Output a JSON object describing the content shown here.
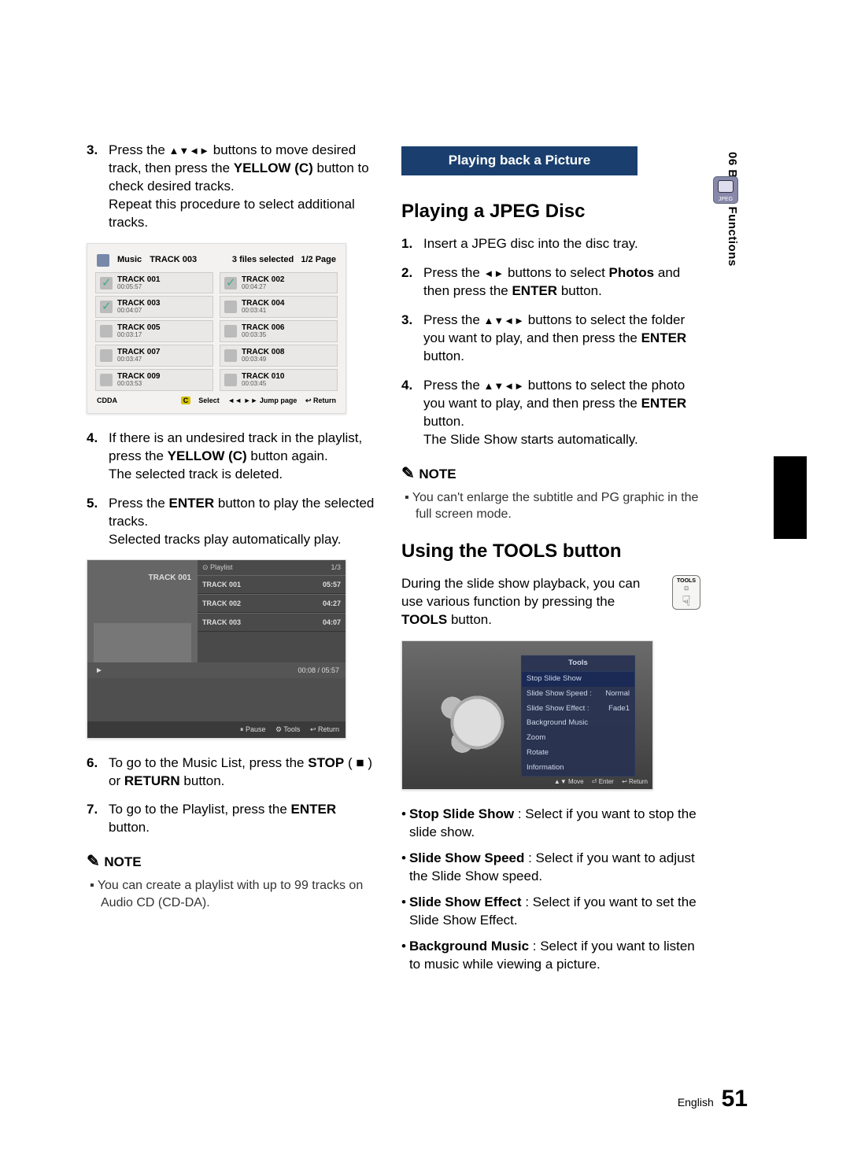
{
  "sideTab": "06 Basic Functions",
  "jpegBadge": "JPEG",
  "left": {
    "step3a": "Press the ",
    "step3arrows": "▲▼◄►",
    "step3b": " buttons to move desired track, then press the ",
    "step3c": "YELLOW (C)",
    "step3d": " button to check desired tracks.",
    "step3e": "Repeat this procedure to select additional tracks.",
    "step4a": "If there is an undesired track in the playlist, press the ",
    "step4b": "YELLOW (C)",
    "step4c": " button again.",
    "step4d": "The selected track is deleted.",
    "step5a": "Press the ",
    "step5b": "ENTER",
    "step5c": " button to play the selected tracks.",
    "step5d": "Selected tracks play automatically play.",
    "step6a": "To go to the Music List, press the ",
    "step6b": "STOP",
    "step6c": " ( ■ ) or ",
    "step6d": "RETURN",
    "step6e": " button.",
    "step7a": "To go to the Playlist, press the ",
    "step7b": "ENTER",
    "step7c": " button.",
    "noteHead": "NOTE",
    "note1": "You can create a playlist with up to 99 tracks on Audio CD (CD-DA)."
  },
  "musicFig": {
    "title": "Music",
    "current": "TRACK 003",
    "selected": "3 files selected",
    "page": "1/2 Page",
    "tracks": [
      {
        "t": "TRACK 001",
        "d": "00:05:57",
        "sel": true
      },
      {
        "t": "TRACK 002",
        "d": "00:04:27",
        "sel": true
      },
      {
        "t": "TRACK 003",
        "d": "00:04:07",
        "sel": true
      },
      {
        "t": "TRACK 004",
        "d": "00:03:41",
        "sel": false
      },
      {
        "t": "TRACK 005",
        "d": "00:03:17",
        "sel": false
      },
      {
        "t": "TRACK 006",
        "d": "00:03:35",
        "sel": false
      },
      {
        "t": "TRACK 007",
        "d": "00:03:47",
        "sel": false
      },
      {
        "t": "TRACK 008",
        "d": "00:03:49",
        "sel": false
      },
      {
        "t": "TRACK 009",
        "d": "00:03:53",
        "sel": false
      },
      {
        "t": "TRACK 010",
        "d": "00:03:45",
        "sel": false
      }
    ],
    "footLeft": "CDDA",
    "footSelect": "Select",
    "footJump": "◄◄ ►► Jump page",
    "footReturn": "↩ Return"
  },
  "playlistFig": {
    "head": "Playlist",
    "page": "1/3",
    "now": "TRACK 001",
    "time": "00:08 / 05:57",
    "rows": [
      {
        "t": "TRACK 001",
        "d": "05:57"
      },
      {
        "t": "TRACK 002",
        "d": "04:27"
      },
      {
        "t": "TRACK 003",
        "d": "04:07"
      }
    ],
    "footPause": "⏸ Pause",
    "footTools": "⚙ Tools",
    "footReturn": "↩ Return"
  },
  "right": {
    "sectionBar": "Playing back a Picture",
    "h2a": "Playing a JPEG Disc",
    "s1": "Insert a JPEG disc into the disc tray.",
    "s2a": "Press the ",
    "s2arrows": "◄►",
    "s2b": " buttons to select ",
    "s2c": "Photos",
    "s2d": " and then press the ",
    "s2e": "ENTER",
    "s2f": " button.",
    "s3a": "Press the ",
    "s3arrows": "▲▼◄►",
    "s3b": " buttons to select the folder you want to play, and then press the ",
    "s3c": "ENTER",
    "s3d": " button.",
    "s4a": "Press the ",
    "s4arrows": "▲▼◄►",
    "s4b": " buttons to select the photo you want to play, and then press the ",
    "s4c": "ENTER",
    "s4d": " button.",
    "s4e": "The Slide Show starts automatically.",
    "noteHead": "NOTE",
    "note1": "You can't enlarge the subtitle and PG graphic in the full screen mode.",
    "h2b": "Using the TOOLS button",
    "toolsPara1": "During the slide show playback, you can use various function by pressing the ",
    "toolsPara2": "TOOLS",
    "toolsPara3": " button.",
    "toolsBtnLabel": "TOOLS",
    "bullets": [
      {
        "t": "Stop Slide Show",
        "d": " : Select if you want to stop the slide show."
      },
      {
        "t": "Slide Show Speed",
        "d": " : Select if you want to adjust the Slide Show speed."
      },
      {
        "t": "Slide Show Effect",
        "d": " : Select if you want to set the Slide Show Effect."
      },
      {
        "t": "Background Music",
        "d": " : Select if you want to listen to music while viewing a picture."
      }
    ]
  },
  "toolsFig": {
    "title": "Tools",
    "items": [
      {
        "l": "Stop Slide Show",
        "r": ""
      },
      {
        "l": "Slide Show Speed :",
        "r": "Normal"
      },
      {
        "l": "Slide Show Effect  :",
        "r": "Fade1"
      },
      {
        "l": "Background Music",
        "r": ""
      },
      {
        "l": "Zoom",
        "r": ""
      },
      {
        "l": "Rotate",
        "r": ""
      },
      {
        "l": "Information",
        "r": ""
      }
    ],
    "footMove": "▲▼ Move",
    "footEnter": "⏎ Enter",
    "footReturn": "↩ Return"
  },
  "footer": {
    "lang": "English",
    "page": "51"
  }
}
